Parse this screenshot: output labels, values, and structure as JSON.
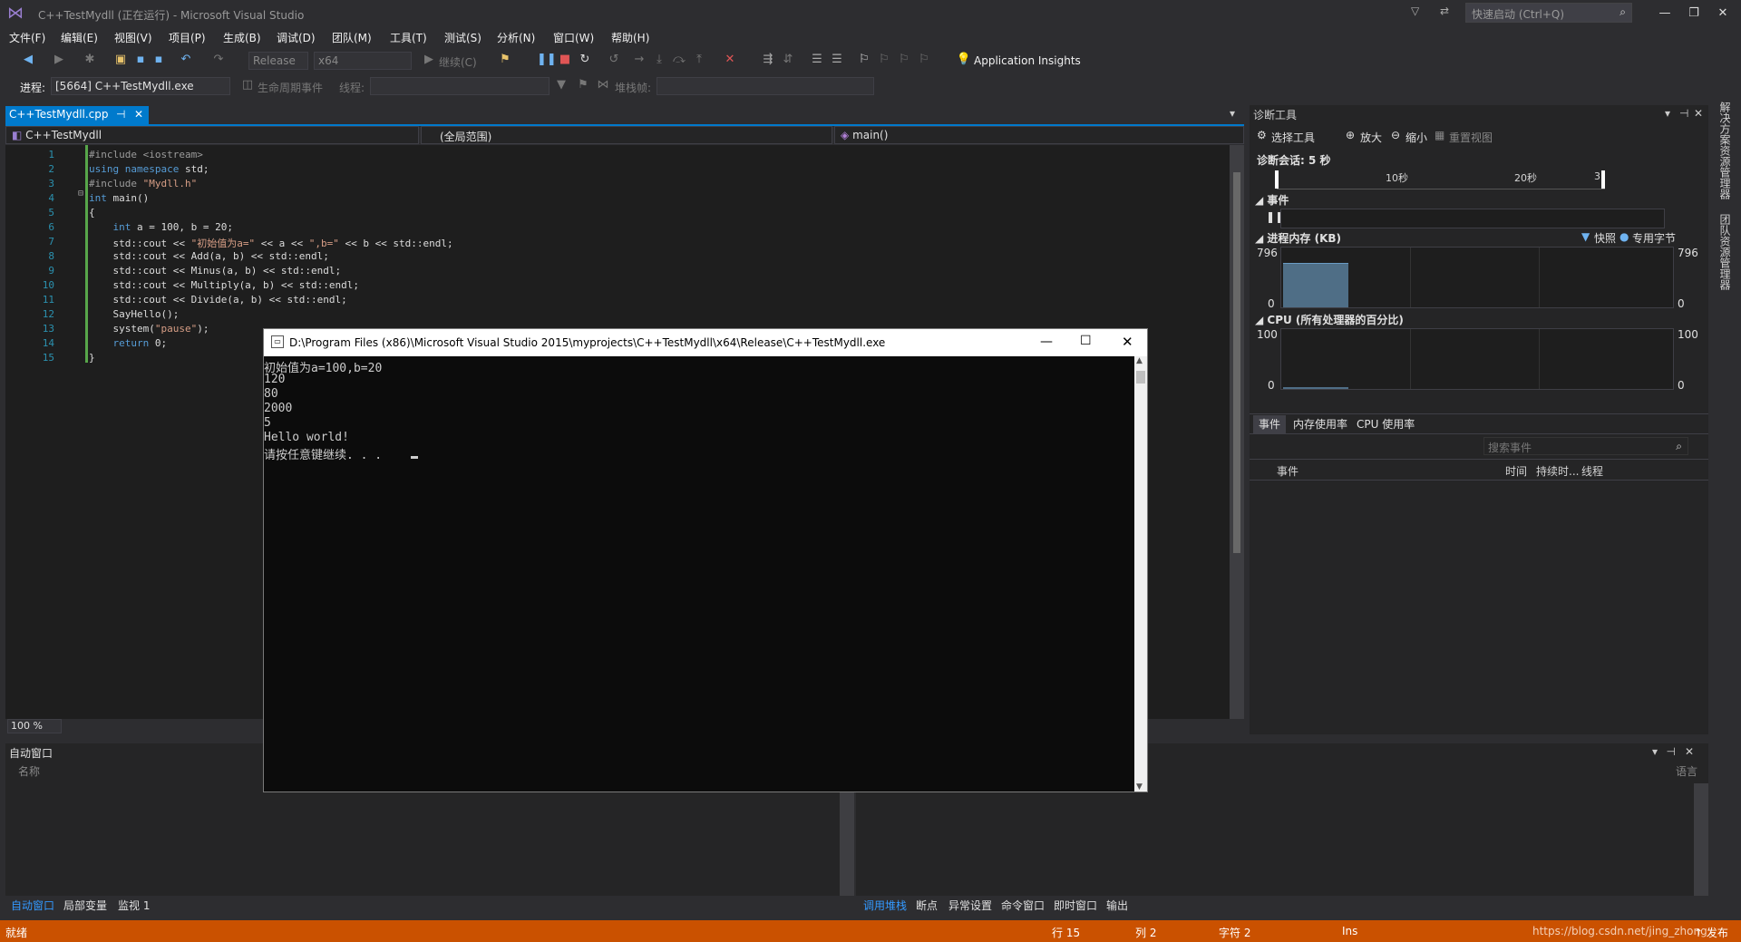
{
  "window": {
    "title": "C++TestMydll (正在运行) - Microsoft Visual Studio",
    "quick_launch_placeholder": "快速启动 (Ctrl+Q)"
  },
  "menu": [
    "文件(F)",
    "编辑(E)",
    "视图(V)",
    "项目(P)",
    "生成(B)",
    "调试(D)",
    "团队(M)",
    "工具(T)",
    "测试(S)",
    "分析(N)",
    "窗口(W)",
    "帮助(H)"
  ],
  "toolbar": {
    "config": "Release",
    "platform": "x64",
    "continue": "继续(C)",
    "app_insights": "Application Insights",
    "process_label": "进程:",
    "process_value": "[5664] C++TestMydll.exe",
    "lifecycle": "生命周期事件",
    "thread_label": "线程:",
    "stackframe_label": "堆栈帧:"
  },
  "editor": {
    "tab": "C++TestMydll.cpp",
    "nav_project": "C++TestMydll",
    "nav_scope": "(全局范围)",
    "nav_member": "main()",
    "zoom": "100 %",
    "lines": [
      {
        "n": "1",
        "html": "<span class='pp'>#include &lt;iostream&gt;</span>"
      },
      {
        "n": "2",
        "html": "<span class='kw'>using namespace</span> std;"
      },
      {
        "n": "3",
        "html": "<span class='pp'>#include </span><span class='str'>\"Mydll.h\"</span>"
      },
      {
        "n": "4",
        "html": "<span class='kw'>int</span> main()"
      },
      {
        "n": "5",
        "html": "{"
      },
      {
        "n": "6",
        "html": "    <span class='kw'>int</span> a = 100, b = 20;"
      },
      {
        "n": "7",
        "html": "    std::cout &lt;&lt; <span class='str'>\"初始值为a=\"</span> &lt;&lt; a &lt;&lt; <span class='str'>\",b=\"</span> &lt;&lt; b &lt;&lt; std::endl;"
      },
      {
        "n": "8",
        "html": "    std::cout &lt;&lt; Add(a, b) &lt;&lt; std::endl;"
      },
      {
        "n": "9",
        "html": "    std::cout &lt;&lt; Minus(a, b) &lt;&lt; std::endl;"
      },
      {
        "n": "10",
        "html": "    std::cout &lt;&lt; Multiply(a, b) &lt;&lt; std::endl;"
      },
      {
        "n": "11",
        "html": "    std::cout &lt;&lt; Divide(a, b) &lt;&lt; std::endl;"
      },
      {
        "n": "12",
        "html": "    SayHello();"
      },
      {
        "n": "13",
        "html": "    system(<span class='str'>\"pause\"</span>);"
      },
      {
        "n": "14",
        "html": "    <span class='kw'>return</span> 0;"
      },
      {
        "n": "15",
        "html": "}"
      }
    ]
  },
  "console": {
    "title": "D:\\Program Files (x86)\\Microsoft Visual Studio 2015\\myprojects\\C++TestMydll\\x64\\Release\\C++TestMydll.exe",
    "output": [
      "初始值为a=100,b=20",
      "120",
      "80",
      "2000",
      "5",
      "Hello world!",
      "请按任意键继续. . ."
    ]
  },
  "diagnostics": {
    "title": "诊断工具",
    "select_tools": "选择工具",
    "zoom_in": "放大",
    "zoom_out": "缩小",
    "reset_view": "重置视图",
    "session": "诊断会话: 5 秒",
    "ticks": [
      "10秒",
      "20秒",
      "3"
    ],
    "events_label": "事件",
    "memory_label": "进程内存 (KB)",
    "memory_legend": [
      "快照",
      "专用字节"
    ],
    "memory_max": "796",
    "memory_min": "0",
    "memory_level": 0.72,
    "cpu_label": "CPU (所有处理器的百分比)",
    "cpu_max": "100",
    "cpu_min": "0",
    "tabs": [
      "事件",
      "内存使用率",
      "CPU 使用率"
    ],
    "search_placeholder": "搜索事件",
    "columns": [
      "事件",
      "时间",
      "持续时...",
      "线程"
    ]
  },
  "right_tabs": [
    "解决方案资源管理器",
    "团队资源管理器"
  ],
  "autos": {
    "title": "自动窗口",
    "col_name": "名称",
    "col_lang": "语言",
    "tabs": [
      "自动窗口",
      "局部变量",
      "监视 1"
    ]
  },
  "callstack_tabs": [
    "调用堆栈",
    "断点",
    "异常设置",
    "命令窗口",
    "即时窗口",
    "输出"
  ],
  "status": {
    "ready": "就绪",
    "line": "行 15",
    "col": "列 2",
    "ch": "字符 2",
    "ins": "Ins",
    "watermark": "https://blog.csdn.net/jing_zhong",
    "publish": "↑ 发布"
  }
}
